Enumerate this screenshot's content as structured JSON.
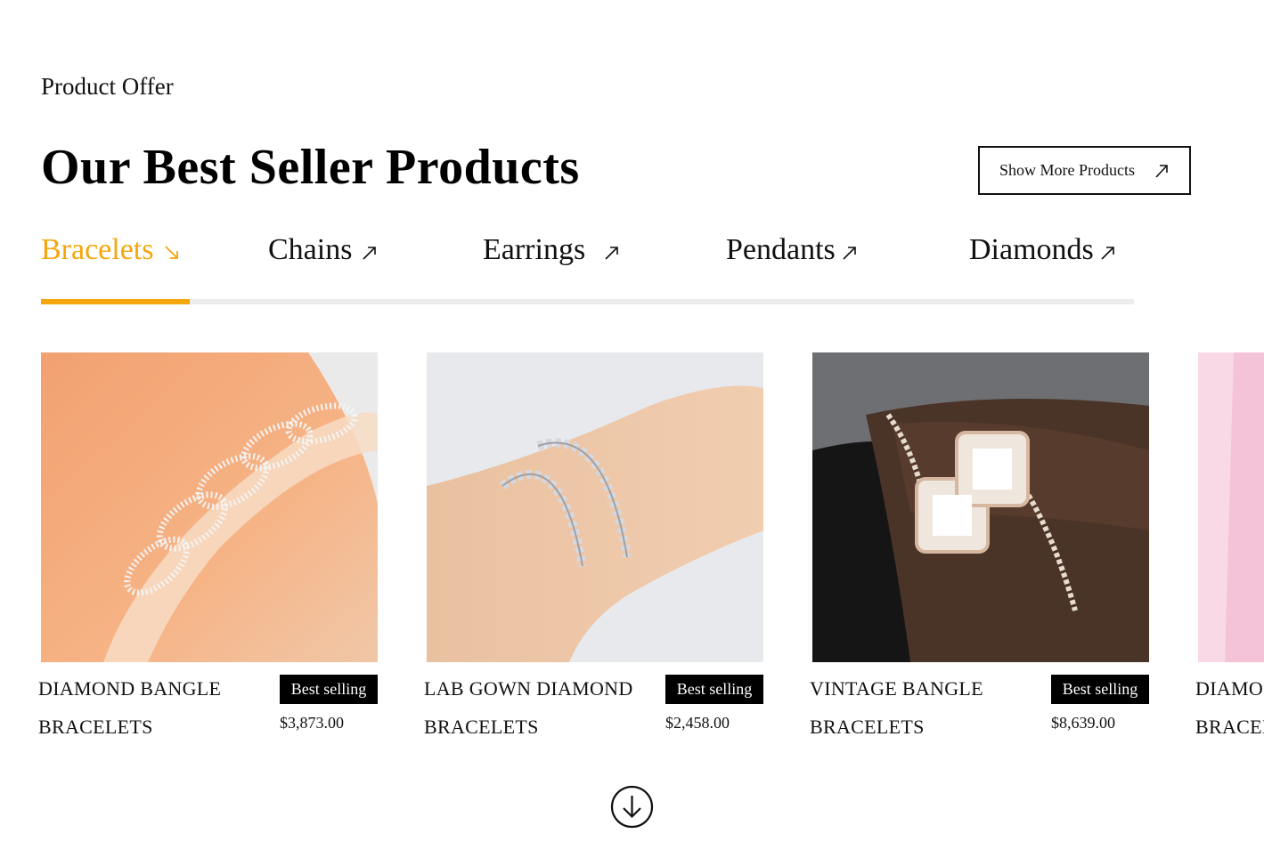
{
  "section": {
    "eyebrow": "Product Offer",
    "title": "Our Best Seller Products",
    "show_more_label": "Show More Products"
  },
  "tabs": [
    {
      "label": "Bracelets",
      "active": true
    },
    {
      "label": "Chains",
      "active": false
    },
    {
      "label": "Earrings",
      "active": false
    },
    {
      "label": "Pendants",
      "active": false
    },
    {
      "label": "Diamonds",
      "active": false
    }
  ],
  "products": [
    {
      "name_line1": "DIAMOND BANGLE",
      "name_line2": "BRACELETS",
      "badge": "Best selling",
      "price": "$3,873.00"
    },
    {
      "name_line1": "LAB GOWN DIAMOND",
      "name_line2": "BRACELETS",
      "badge": "Best selling",
      "price": "$2,458.00"
    },
    {
      "name_line1": "VINTAGE BANGLE",
      "name_line2": "BRACELETS",
      "badge": "Best selling",
      "price": "$8,639.00"
    },
    {
      "name_line1": "DIAMO",
      "name_line2": "BRACEI"
    }
  ],
  "colors": {
    "accent": "#f5a60c",
    "badge_bg": "#000000",
    "tab_track": "#ececec"
  },
  "icons": {
    "active_tab": "arrow-down-right-icon",
    "inactive_tab": "arrow-up-right-icon",
    "show_more": "arrow-up-right-icon",
    "scroll": "circle-arrow-down-icon"
  }
}
